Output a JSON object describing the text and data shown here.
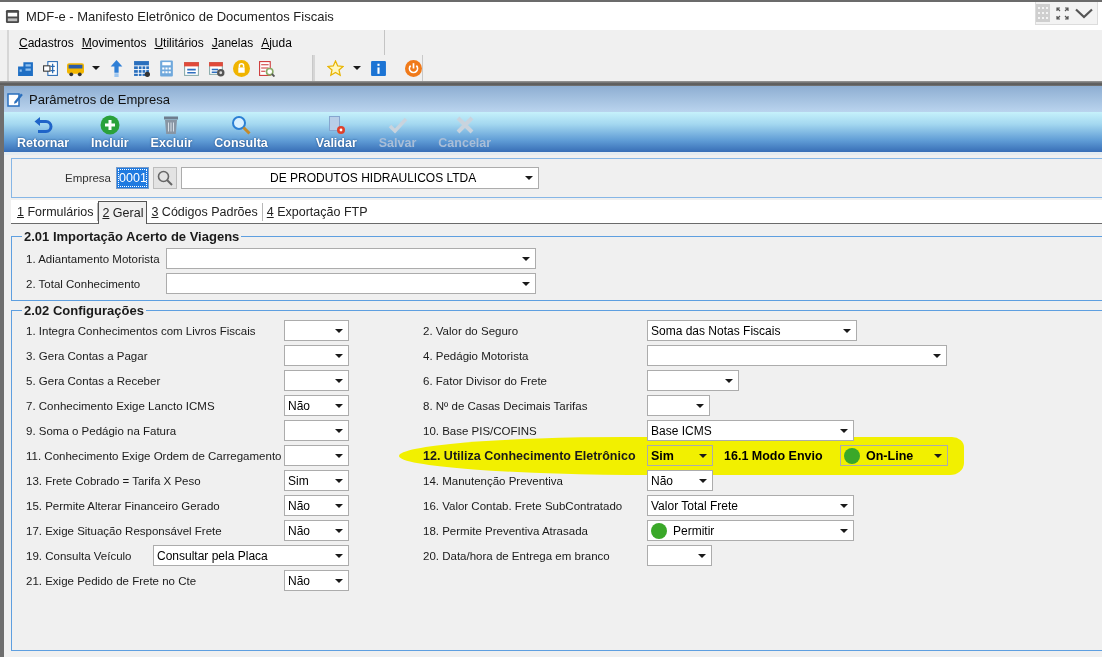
{
  "window": {
    "title": "MDF-e - Manifesto Eletrônico de Documentos Fiscais"
  },
  "menu": [
    {
      "label": "Cadastros"
    },
    {
      "label": "Movimentos"
    },
    {
      "label": "Utilitários"
    },
    {
      "label": "Janelas"
    },
    {
      "label": "Ajuda"
    }
  ],
  "form": {
    "title": "Parâmetros de Empresa",
    "actions": [
      {
        "label": "Retornar",
        "disabled": false
      },
      {
        "label": "Incluir",
        "disabled": false
      },
      {
        "label": "Excluir",
        "disabled": false
      },
      {
        "label": "Consulta",
        "disabled": false
      },
      {
        "label": "Validar",
        "disabled": false
      },
      {
        "label": "Salvar",
        "disabled": true
      },
      {
        "label": "Cancelar",
        "disabled": true
      }
    ]
  },
  "company": {
    "label": "Empresa",
    "code": {
      "value": "0001",
      "selected": true
    },
    "name": "DE PRODUTOS HIDRAULICOS LTDA"
  },
  "tabs": [
    {
      "key": "1",
      "label": "Formulários",
      "selected": false
    },
    {
      "key": "2",
      "label": "Geral",
      "selected": true
    },
    {
      "key": "3",
      "label": "Códigos Padrões",
      "selected": false
    },
    {
      "key": "4",
      "label": "Exportação FTP",
      "selected": false
    }
  ],
  "import_group": {
    "title": "2.01 Importação Acerto de Viagens",
    "fields": [
      {
        "label": "1. Adiantamento Motorista"
      },
      {
        "label": "2. Total Conhecimento"
      }
    ]
  },
  "config_group": {
    "title": "2.02 Configurações",
    "left": [
      {
        "label": "1. Integra Conhecimentos com Livros Fiscais"
      },
      {
        "label": "3. Gera Contas a Pagar"
      },
      {
        "label": "5. Gera Contas a Receber"
      },
      {
        "label": "7. Conhecimento Exige Lancto ICMS",
        "value": "Não"
      },
      {
        "label": "9. Soma o Pedágio na Fatura"
      },
      {
        "label": "11. Conhecimento Exige Ordem de Carregamento"
      },
      {
        "label": "13. Frete Cobrado = Tarifa X Peso",
        "value": "Sim"
      },
      {
        "label": "15. Permite Alterar Financeiro Gerado",
        "value": "Não"
      },
      {
        "label": "17. Exige Situação Responsável Frete",
        "value": "Não"
      },
      {
        "label": "19. Consulta Veículo",
        "value": "Consultar pela Placa"
      },
      {
        "label": "21. Exige Pedido de Frete no Cte",
        "value": "Não"
      }
    ],
    "right": [
      {
        "label": "2. Valor do Seguro",
        "value": "Soma das Notas Fiscais",
        "highlighted": false
      },
      {
        "label": "4. Pedágio Motorista",
        "highlighted": false
      },
      {
        "label": "6. Fator Divisor do Frete",
        "highlighted": false
      },
      {
        "label": "8. Nº de Casas Decimais Tarifas",
        "highlighted": false
      },
      {
        "label": "10. Base PIS/COFINS",
        "value": "Base ICMS",
        "highlighted": false
      },
      {
        "label": "12. Utiliza Conhecimento Eletrônico",
        "value": "Sim",
        "highlighted": true,
        "extra": {
          "label": "16.1 Modo Envio",
          "value": "On-Line",
          "color": "#3aa829"
        }
      },
      {
        "label": "14. Manutenção Preventiva",
        "value": "Não",
        "highlighted": false
      },
      {
        "label": "16. Valor Contab. Frete SubContratado",
        "value": "Valor Total Frete",
        "highlighted": false
      },
      {
        "label": "18. Permite Preventiva Atrasada",
        "value": "Permitir",
        "color": "#3aa829",
        "highlighted": false
      },
      {
        "label": "20. Data/hora de Entrega em branco",
        "highlighted": false
      }
    ]
  }
}
